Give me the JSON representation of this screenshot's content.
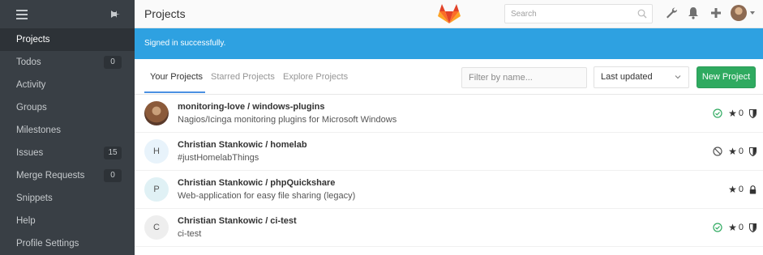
{
  "sidebar": {
    "items": [
      {
        "label": "Projects",
        "count": null
      },
      {
        "label": "Todos",
        "count": "0"
      },
      {
        "label": "Activity",
        "count": null
      },
      {
        "label": "Groups",
        "count": null
      },
      {
        "label": "Milestones",
        "count": null
      },
      {
        "label": "Issues",
        "count": "15"
      },
      {
        "label": "Merge Requests",
        "count": "0"
      },
      {
        "label": "Snippets",
        "count": null
      },
      {
        "label": "Help",
        "count": null
      },
      {
        "label": "Profile Settings",
        "count": null
      }
    ]
  },
  "header": {
    "title": "Projects",
    "search_placeholder": "Search"
  },
  "flash": {
    "message": "Signed in successfully."
  },
  "tabs": {
    "your": "Your Projects",
    "starred": "Starred Projects",
    "explore": "Explore Projects"
  },
  "filter": {
    "placeholder": "Filter by name...",
    "sort_value": "Last updated",
    "new_project_label": "New Project"
  },
  "projects": [
    {
      "avatar": "",
      "title": "monitoring-love / windows-plugins",
      "description": "Nagios/Icinga monitoring plugins for Microsoft Windows",
      "stars": "0",
      "status": "success",
      "visibility": "internal"
    },
    {
      "avatar": "H",
      "title": "Christian Stankowic / homelab",
      "description": "#justHomelabThings",
      "stars": "0",
      "status": "canceled",
      "visibility": "internal"
    },
    {
      "avatar": "P",
      "title": "Christian Stankowic / phpQuickshare",
      "description": "Web-application for easy file sharing (legacy)",
      "stars": "0",
      "status": "none",
      "visibility": "private"
    },
    {
      "avatar": "C",
      "title": "Christian Stankowic / ci-test",
      "description": "ci-test",
      "stars": "0",
      "status": "success",
      "visibility": "internal"
    }
  ],
  "colors": {
    "sidebar": "#393f45",
    "flash": "#2ea1e1",
    "new_button": "#2faa60",
    "success": "#2faa60",
    "tab_active_underline": "#4a90e2"
  },
  "icons": {
    "hamburger": "hamburger-icon",
    "pin": "pin-icon",
    "logo": "gitlab-logo",
    "search": "search-icon",
    "wrench": "wrench-icon",
    "bell": "bell-icon",
    "plus": "plus-icon",
    "star": "star-icon",
    "shield": "shield-icon",
    "lock": "lock-icon"
  }
}
